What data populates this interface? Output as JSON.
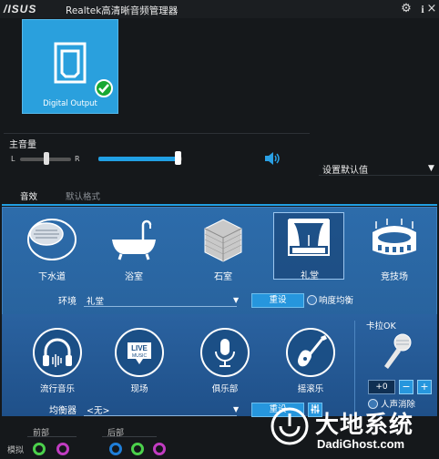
{
  "titlebar": {
    "logo": "/ISUS",
    "title": "Realtek高清晰音频管理器",
    "icons": [
      "gear-icon",
      "info-icon",
      "minimize-icon",
      "close-icon"
    ]
  },
  "device": {
    "label": "Digital Output",
    "status_icon": "check-icon"
  },
  "volume": {
    "label": "主音量",
    "left": "L",
    "right": "R",
    "level_percent": 96,
    "balance_fraction": 0.5
  },
  "default_device": {
    "label": "设置默认值"
  },
  "tabs": [
    {
      "label": "音效",
      "active": true
    },
    {
      "label": "默认格式",
      "active": false
    }
  ],
  "environments": [
    {
      "label": "下水道",
      "icon": "sewer-pipe-icon"
    },
    {
      "label": "浴室",
      "icon": "bathtub-icon"
    },
    {
      "label": "石室",
      "icon": "stone-room-icon"
    },
    {
      "label": "礼堂",
      "icon": "auditorium-stage-icon",
      "selected": true
    },
    {
      "label": "竞技场",
      "icon": "arena-icon"
    }
  ],
  "environment_row": {
    "label": "环境",
    "value": "礼堂",
    "reset": "重设",
    "loudness": "响度均衡"
  },
  "equalizer_presets": [
    {
      "label": "流行音乐",
      "icon": "headphones-icon"
    },
    {
      "label": "现场",
      "icon": "live-music-icon"
    },
    {
      "label": "俱乐部",
      "icon": "microphone-icon"
    },
    {
      "label": "摇滚乐",
      "icon": "guitar-icon"
    }
  ],
  "equalizer_row": {
    "label": "均衡器",
    "value": "<无>",
    "reset": "重设"
  },
  "karaoke": {
    "label": "卡拉OK",
    "value": "+0",
    "minus": "−",
    "plus": "+",
    "vocal_cancel": "人声消除"
  },
  "bottom": {
    "analog": "模拟",
    "front": "前部",
    "rear": "后部"
  },
  "watermark": {
    "title": "大地系统",
    "url": "DadiGhost.com"
  },
  "colors": {
    "accent": "#21a0e4",
    "panel": "#2a66a3",
    "tile": "#2aa0dd",
    "check": "#18a832"
  }
}
